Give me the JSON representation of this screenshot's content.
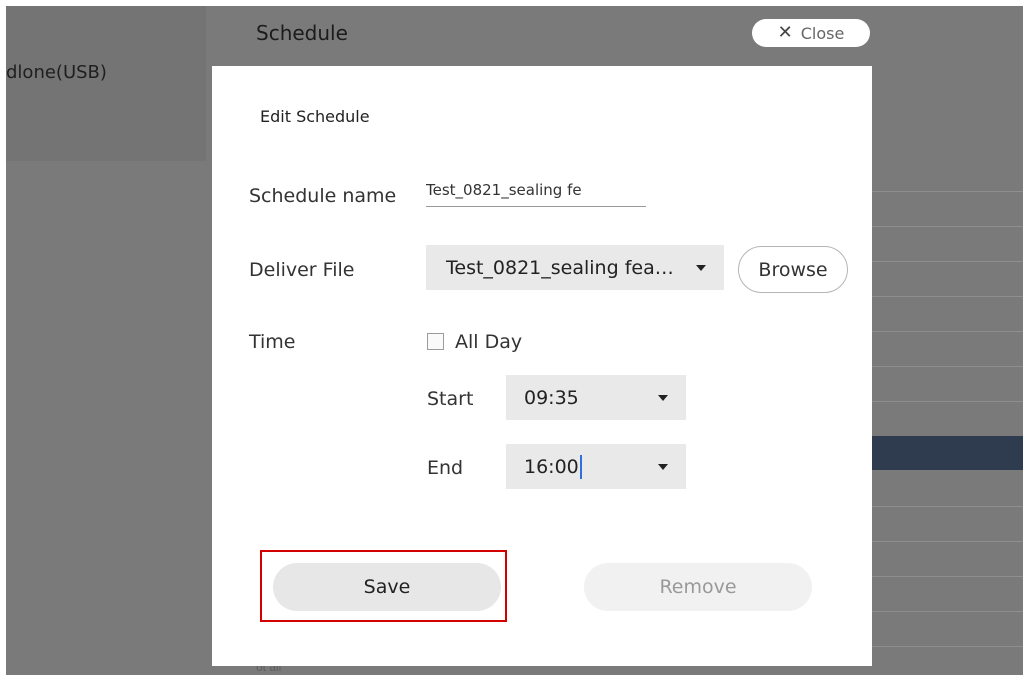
{
  "background": {
    "device_label": "dlone(USB)",
    "page_title": "Schedule",
    "bottom_text": "ot all"
  },
  "close_button": {
    "label": "Close",
    "icon": "close-icon"
  },
  "dialog": {
    "title": "Edit Schedule",
    "schedule_name": {
      "label": "Schedule name",
      "value": "Test_0821_sealing fe"
    },
    "deliver_file": {
      "label": "Deliver File",
      "selected": "Test_0821_sealing fea…",
      "browse_label": "Browse"
    },
    "time": {
      "label": "Time",
      "all_day_label": "All Day",
      "all_day_checked": false,
      "start_label": "Start",
      "start_value": "09:35",
      "end_label": "End",
      "end_value": "16:00"
    },
    "save_label": "Save",
    "remove_label": "Remove"
  },
  "colors": {
    "overlay": "#7a7a7a",
    "highlight_border": "#d40000",
    "selected_row": "#2f3c4f",
    "caret_cursor": "#2f6fe0"
  }
}
